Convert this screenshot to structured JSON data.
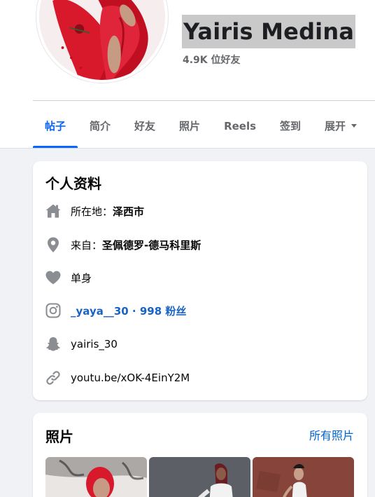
{
  "profile": {
    "name": "Yairis Medina",
    "friends": "4.9K 位好友"
  },
  "tabs": [
    {
      "label": "帖子",
      "active": true
    },
    {
      "label": "简介"
    },
    {
      "label": "好友"
    },
    {
      "label": "照片"
    },
    {
      "label": "Reels"
    },
    {
      "label": "签到"
    },
    {
      "label": "展开"
    }
  ],
  "intro": {
    "title": "个人资料",
    "lives_prefix": "所在地：",
    "lives_value": "泽西市",
    "from_prefix": "来自：",
    "from_value": "圣佩德罗-德马科里斯",
    "relationship": "单身",
    "instagram": "_yaya__30 · 998 粉丝",
    "snapchat": "yairis_30",
    "website": "youtu.be/xOK-4EinY2M"
  },
  "photos": {
    "title": "照片",
    "see_all": "所有照片",
    "items": [
      "photo-1",
      "photo-2",
      "photo-3"
    ]
  },
  "icons": {
    "home": "home-icon",
    "location": "map-pin-icon",
    "heart": "heart-icon",
    "instagram": "instagram-icon",
    "snapchat": "snapchat-icon",
    "link": "link-icon",
    "caret": "caret-down-icon"
  },
  "colors": {
    "accent": "#0866ff",
    "link": "#1a63c6",
    "secondary_text": "#65676b",
    "icon_gray": "#8a8d91",
    "page_bg": "#f0f2f5"
  }
}
